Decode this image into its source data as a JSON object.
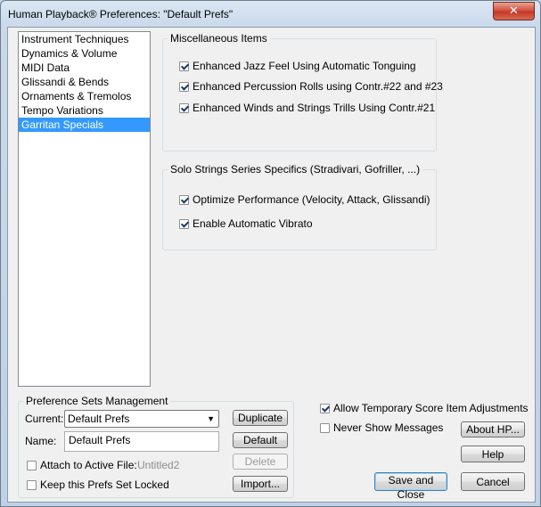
{
  "window": {
    "title": "Human Playback® Preferences: \"Default Prefs\"",
    "close_glyph": "✕"
  },
  "categories": [
    "Instrument Techniques",
    "Dynamics & Volume",
    "MIDI Data",
    "Glissandi & Bends",
    "Ornaments & Tremolos",
    "Tempo Variations",
    "Garritan Specials"
  ],
  "selected_category": "Garritan Specials",
  "misc": {
    "legend": "Miscellaneous Items",
    "jazz": "Enhanced Jazz Feel Using Automatic Tonguing",
    "percussion": "Enhanced Percussion Rolls using Contr.#22 and #23",
    "winds": "Enhanced Winds and Strings Trills Using Contr.#21"
  },
  "solo": {
    "legend": "Solo Strings Series Specifics (Stradivari, Gofriller, ...)",
    "optimize": "Optimize Performance (Velocity, Attack, Glissandi)",
    "vibrato": "Enable Automatic Vibrato"
  },
  "prefsets": {
    "legend": "Preference Sets Management",
    "current_label": "Current:",
    "current_value": "Default Prefs",
    "name_label": "Name:",
    "name_value": "Default Prefs",
    "attach_label": "Attach to Active File:",
    "attach_file": "Untitled2",
    "locked_label": "Keep this Prefs Set Locked",
    "duplicate": "Duplicate",
    "default": "Default",
    "delete": "Delete",
    "import": "Import..."
  },
  "options": {
    "allow_temp": "Allow Temporary Score Item Adjustments",
    "never_show": "Never Show Messages"
  },
  "buttons": {
    "about": "About HP...",
    "help": "Help",
    "save_close": "Save and Close",
    "cancel": "Cancel"
  }
}
